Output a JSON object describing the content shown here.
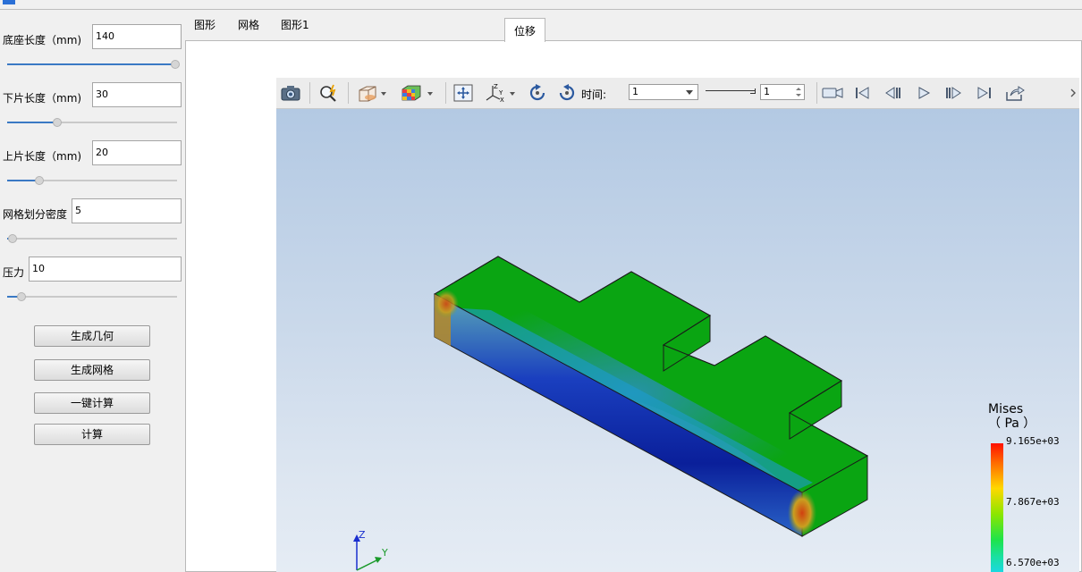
{
  "left_panel": {
    "params": [
      {
        "label": "底座长度（mm)",
        "value": "140",
        "slider_fraction": 1.0
      },
      {
        "label": "下片长度（mm)",
        "value": "30",
        "slider_fraction": 0.29
      },
      {
        "label": "上片长度（mm)",
        "value": "20",
        "slider_fraction": 0.19
      },
      {
        "label": "网格划分密度",
        "value": "5",
        "slider_fraction": 0.03
      },
      {
        "label": "压力",
        "value": "10",
        "slider_fraction": 0.08
      }
    ],
    "buttons": [
      "生成几何",
      "生成网格",
      "一键计算",
      "计算"
    ]
  },
  "tabs": [
    "图形",
    "网格",
    "图形1",
    "位移"
  ],
  "active_tab": "位移",
  "toolbar": {
    "time_label": "时间:",
    "time_value": "1",
    "step_value": "1",
    "icons": [
      "camera-icon",
      "zoom-icon",
      "display-style-icon",
      "color-cube-icon",
      "fit-view-icon",
      "axes-icon",
      "rotate-cw-icon",
      "rotate-ccw-icon",
      "record-icon",
      "first-frame-icon",
      "prev-frame-icon",
      "play-icon",
      "next-frame-icon",
      "last-frame-icon",
      "export-icon"
    ]
  },
  "legend": {
    "title_line1": "Mises",
    "title_line2": "（ Pa ）",
    "max": "9.165e+03",
    "mid": "7.867e+03",
    "min": "6.570e+03"
  },
  "triad": {
    "z": "Z",
    "y": "Y"
  }
}
